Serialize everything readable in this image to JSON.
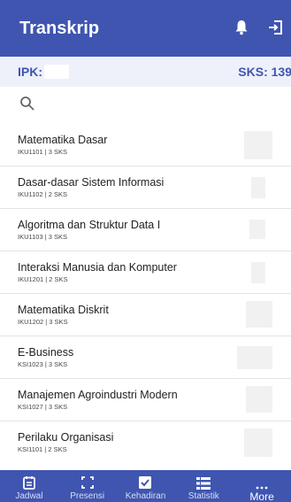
{
  "appbar": {
    "title": "Transkrip",
    "icons": [
      "bell-icon",
      "logout-icon"
    ]
  },
  "summary": {
    "ipk_label": "IPK:",
    "sks_label": "SKS: 139"
  },
  "search": {
    "icon": "search-icon"
  },
  "courses": [
    {
      "name": "Matematika Dasar",
      "meta": "IKU1101 | 3 SKS"
    },
    {
      "name": "Dasar-dasar Sistem Informasi",
      "meta": "IKU1102 | 2 SKS"
    },
    {
      "name": "Algoritma dan Struktur Data I",
      "meta": "IKU1103 | 3 SKS"
    },
    {
      "name": "Interaksi Manusia dan Komputer",
      "meta": "IKU1201 | 2 SKS"
    },
    {
      "name": "Matematika Diskrit",
      "meta": "IKU1202 | 3 SKS"
    },
    {
      "name": "E-Business",
      "meta": "KSI1023 | 3 SKS"
    },
    {
      "name": "Manajemen Agroindustri Modern",
      "meta": "KSI1027 | 3 SKS"
    },
    {
      "name": "Perilaku Organisasi",
      "meta": "KSI1101 | 2 SKS"
    }
  ],
  "bottom_nav": [
    {
      "label": "Jadwal",
      "icon": "calendar-icon"
    },
    {
      "label": "Presensi",
      "icon": "scan-icon"
    },
    {
      "label": "Kehadiran",
      "icon": "checkbox-icon"
    },
    {
      "label": "Statistik",
      "icon": "list-icon"
    },
    {
      "label": "More",
      "icon": "more-icon"
    }
  ],
  "colors": {
    "primary": "#3f55b0",
    "summary_bg": "#eef0fa"
  }
}
